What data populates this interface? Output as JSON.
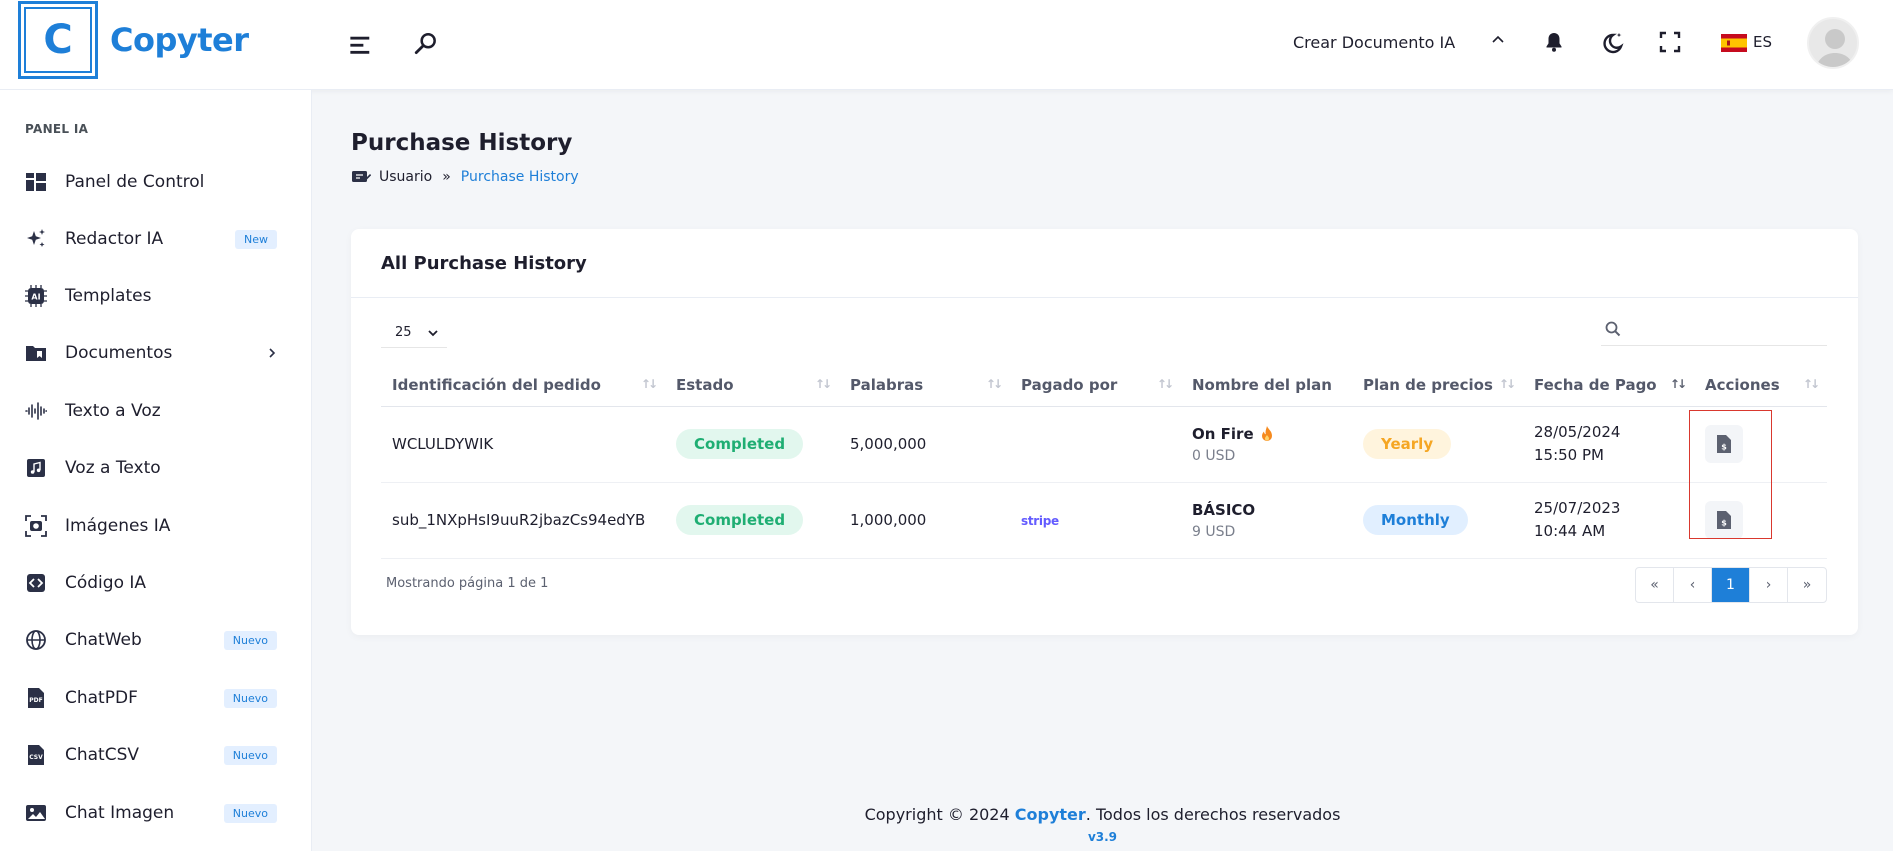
{
  "brand": {
    "logo_letter": "C",
    "name": "Copyter",
    "accent": "#1e7fd8"
  },
  "header": {
    "create_doc": "Crear Documento IA",
    "lang": "ES",
    "icons": [
      "menu-icon",
      "search-icon",
      "chevron-up-icon",
      "bell-icon",
      "moon-icon",
      "fullscreen-icon",
      "spain-flag-icon",
      "avatar"
    ]
  },
  "sidebar": {
    "category": "PANEL IA",
    "items": [
      {
        "label": "Panel de Control",
        "icon": "dashboard-icon"
      },
      {
        "label": "Redactor IA",
        "icon": "sparkles-icon",
        "badge": "New"
      },
      {
        "label": "Templates",
        "icon": "ai-chip-icon"
      },
      {
        "label": "Documentos",
        "icon": "folder-icon",
        "has_submenu": true
      },
      {
        "label": "Texto a Voz",
        "icon": "soundwave-icon"
      },
      {
        "label": "Voz a Texto",
        "icon": "music-file-icon"
      },
      {
        "label": "Imágenes IA",
        "icon": "camera-icon"
      },
      {
        "label": "Código IA",
        "icon": "code-icon"
      },
      {
        "label": "ChatWeb",
        "icon": "globe-icon",
        "badge": "Nuevo"
      },
      {
        "label": "ChatPDF",
        "icon": "pdf-icon",
        "badge": "Nuevo"
      },
      {
        "label": "ChatCSV",
        "icon": "csv-icon",
        "badge": "Nuevo"
      },
      {
        "label": "Chat Imagen",
        "icon": "image-icon",
        "badge": "Nuevo"
      }
    ]
  },
  "page": {
    "title": "Purchase History",
    "breadcrumb": {
      "home": "Usuario",
      "separator": "»",
      "current": "Purchase History"
    }
  },
  "card": {
    "title": "All Purchase History",
    "page_length": "25",
    "columns": [
      "Identificación del pedido",
      "Estado",
      "Palabras",
      "Pagado por",
      "Nombre del plan",
      "Plan de precios",
      "Fecha de Pago",
      "Acciones"
    ],
    "rows": [
      {
        "order_id": "WCLULDYWIK",
        "status": "Completed",
        "words": "5,000,000",
        "paid_by": "",
        "plan_name": "On Fire",
        "plan_price": "0 USD",
        "pricing": "Yearly",
        "date": "28/05/2024",
        "time": "15:50 PM"
      },
      {
        "order_id": "sub_1NXpHsI9uuR2jbazCs94edYB",
        "status": "Completed",
        "words": "1,000,000",
        "paid_by": "stripe",
        "plan_name": "BÁSICO",
        "plan_price": "9 USD",
        "pricing": "Monthly",
        "date": "25/07/2023",
        "time": "10:44 AM"
      }
    ],
    "showing": "Mostrando página 1 de 1",
    "pager": {
      "first": "«",
      "prev": "‹",
      "current": "1",
      "next": "›",
      "last": "»"
    }
  },
  "footer": {
    "prefix": "Copyright © 2024 ",
    "brand": "Copyter",
    "suffix": ". Todos los derechos reservados",
    "version": "v3.9"
  },
  "colors": {
    "completed": "#1fae73",
    "yearly": "#f5a623",
    "monthly": "#1e7fd8",
    "highlight_box": "#d9382e"
  }
}
